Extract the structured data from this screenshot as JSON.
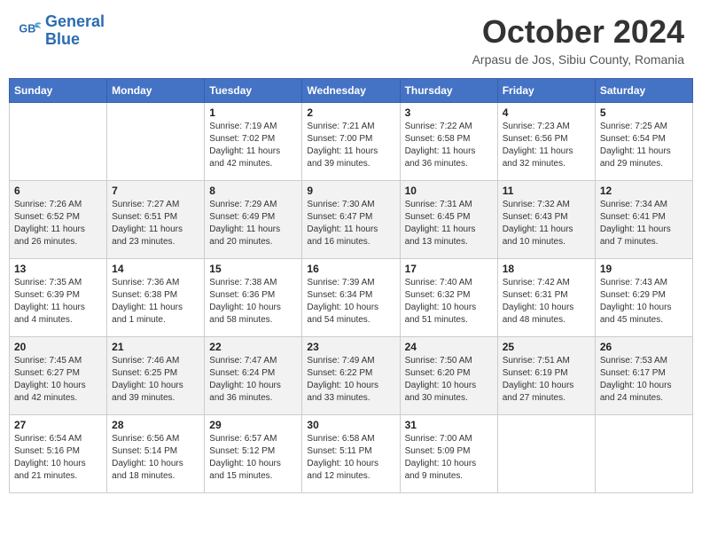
{
  "header": {
    "logo_line1": "General",
    "logo_line2": "Blue",
    "month": "October 2024",
    "location": "Arpasu de Jos, Sibiu County, Romania"
  },
  "weekdays": [
    "Sunday",
    "Monday",
    "Tuesday",
    "Wednesday",
    "Thursday",
    "Friday",
    "Saturday"
  ],
  "weeks": [
    [
      {
        "day": "",
        "sunrise": "",
        "sunset": "",
        "daylight": ""
      },
      {
        "day": "",
        "sunrise": "",
        "sunset": "",
        "daylight": ""
      },
      {
        "day": "1",
        "sunrise": "Sunrise: 7:19 AM",
        "sunset": "Sunset: 7:02 PM",
        "daylight": "Daylight: 11 hours and 42 minutes."
      },
      {
        "day": "2",
        "sunrise": "Sunrise: 7:21 AM",
        "sunset": "Sunset: 7:00 PM",
        "daylight": "Daylight: 11 hours and 39 minutes."
      },
      {
        "day": "3",
        "sunrise": "Sunrise: 7:22 AM",
        "sunset": "Sunset: 6:58 PM",
        "daylight": "Daylight: 11 hours and 36 minutes."
      },
      {
        "day": "4",
        "sunrise": "Sunrise: 7:23 AM",
        "sunset": "Sunset: 6:56 PM",
        "daylight": "Daylight: 11 hours and 32 minutes."
      },
      {
        "day": "5",
        "sunrise": "Sunrise: 7:25 AM",
        "sunset": "Sunset: 6:54 PM",
        "daylight": "Daylight: 11 hours and 29 minutes."
      }
    ],
    [
      {
        "day": "6",
        "sunrise": "Sunrise: 7:26 AM",
        "sunset": "Sunset: 6:52 PM",
        "daylight": "Daylight: 11 hours and 26 minutes."
      },
      {
        "day": "7",
        "sunrise": "Sunrise: 7:27 AM",
        "sunset": "Sunset: 6:51 PM",
        "daylight": "Daylight: 11 hours and 23 minutes."
      },
      {
        "day": "8",
        "sunrise": "Sunrise: 7:29 AM",
        "sunset": "Sunset: 6:49 PM",
        "daylight": "Daylight: 11 hours and 20 minutes."
      },
      {
        "day": "9",
        "sunrise": "Sunrise: 7:30 AM",
        "sunset": "Sunset: 6:47 PM",
        "daylight": "Daylight: 11 hours and 16 minutes."
      },
      {
        "day": "10",
        "sunrise": "Sunrise: 7:31 AM",
        "sunset": "Sunset: 6:45 PM",
        "daylight": "Daylight: 11 hours and 13 minutes."
      },
      {
        "day": "11",
        "sunrise": "Sunrise: 7:32 AM",
        "sunset": "Sunset: 6:43 PM",
        "daylight": "Daylight: 11 hours and 10 minutes."
      },
      {
        "day": "12",
        "sunrise": "Sunrise: 7:34 AM",
        "sunset": "Sunset: 6:41 PM",
        "daylight": "Daylight: 11 hours and 7 minutes."
      }
    ],
    [
      {
        "day": "13",
        "sunrise": "Sunrise: 7:35 AM",
        "sunset": "Sunset: 6:39 PM",
        "daylight": "Daylight: 11 hours and 4 minutes."
      },
      {
        "day": "14",
        "sunrise": "Sunrise: 7:36 AM",
        "sunset": "Sunset: 6:38 PM",
        "daylight": "Daylight: 11 hours and 1 minute."
      },
      {
        "day": "15",
        "sunrise": "Sunrise: 7:38 AM",
        "sunset": "Sunset: 6:36 PM",
        "daylight": "Daylight: 10 hours and 58 minutes."
      },
      {
        "day": "16",
        "sunrise": "Sunrise: 7:39 AM",
        "sunset": "Sunset: 6:34 PM",
        "daylight": "Daylight: 10 hours and 54 minutes."
      },
      {
        "day": "17",
        "sunrise": "Sunrise: 7:40 AM",
        "sunset": "Sunset: 6:32 PM",
        "daylight": "Daylight: 10 hours and 51 minutes."
      },
      {
        "day": "18",
        "sunrise": "Sunrise: 7:42 AM",
        "sunset": "Sunset: 6:31 PM",
        "daylight": "Daylight: 10 hours and 48 minutes."
      },
      {
        "day": "19",
        "sunrise": "Sunrise: 7:43 AM",
        "sunset": "Sunset: 6:29 PM",
        "daylight": "Daylight: 10 hours and 45 minutes."
      }
    ],
    [
      {
        "day": "20",
        "sunrise": "Sunrise: 7:45 AM",
        "sunset": "Sunset: 6:27 PM",
        "daylight": "Daylight: 10 hours and 42 minutes."
      },
      {
        "day": "21",
        "sunrise": "Sunrise: 7:46 AM",
        "sunset": "Sunset: 6:25 PM",
        "daylight": "Daylight: 10 hours and 39 minutes."
      },
      {
        "day": "22",
        "sunrise": "Sunrise: 7:47 AM",
        "sunset": "Sunset: 6:24 PM",
        "daylight": "Daylight: 10 hours and 36 minutes."
      },
      {
        "day": "23",
        "sunrise": "Sunrise: 7:49 AM",
        "sunset": "Sunset: 6:22 PM",
        "daylight": "Daylight: 10 hours and 33 minutes."
      },
      {
        "day": "24",
        "sunrise": "Sunrise: 7:50 AM",
        "sunset": "Sunset: 6:20 PM",
        "daylight": "Daylight: 10 hours and 30 minutes."
      },
      {
        "day": "25",
        "sunrise": "Sunrise: 7:51 AM",
        "sunset": "Sunset: 6:19 PM",
        "daylight": "Daylight: 10 hours and 27 minutes."
      },
      {
        "day": "26",
        "sunrise": "Sunrise: 7:53 AM",
        "sunset": "Sunset: 6:17 PM",
        "daylight": "Daylight: 10 hours and 24 minutes."
      }
    ],
    [
      {
        "day": "27",
        "sunrise": "Sunrise: 6:54 AM",
        "sunset": "Sunset: 5:16 PM",
        "daylight": "Daylight: 10 hours and 21 minutes."
      },
      {
        "day": "28",
        "sunrise": "Sunrise: 6:56 AM",
        "sunset": "Sunset: 5:14 PM",
        "daylight": "Daylight: 10 hours and 18 minutes."
      },
      {
        "day": "29",
        "sunrise": "Sunrise: 6:57 AM",
        "sunset": "Sunset: 5:12 PM",
        "daylight": "Daylight: 10 hours and 15 minutes."
      },
      {
        "day": "30",
        "sunrise": "Sunrise: 6:58 AM",
        "sunset": "Sunset: 5:11 PM",
        "daylight": "Daylight: 10 hours and 12 minutes."
      },
      {
        "day": "31",
        "sunrise": "Sunrise: 7:00 AM",
        "sunset": "Sunset: 5:09 PM",
        "daylight": "Daylight: 10 hours and 9 minutes."
      },
      {
        "day": "",
        "sunrise": "",
        "sunset": "",
        "daylight": ""
      },
      {
        "day": "",
        "sunrise": "",
        "sunset": "",
        "daylight": ""
      }
    ]
  ]
}
